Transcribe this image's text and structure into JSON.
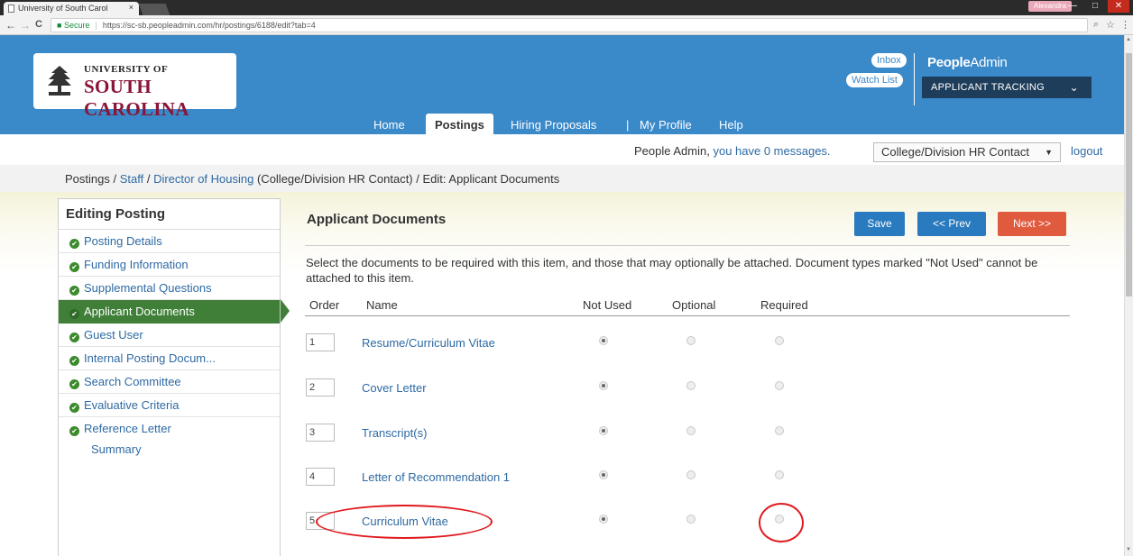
{
  "browser": {
    "tab_title": "University of South Carol",
    "tab_close": "×",
    "url_secure_label": "Secure",
    "url_separator": "|",
    "url": "https://sc-sb.peopleadmin.com/hr/postings/6188/edit?tab=4",
    "user_name": "Alexandra",
    "nav_back": "←",
    "nav_forward": "→",
    "nav_reload": "C",
    "zoom_icon": "zoom-icon",
    "star_icon": "☆",
    "menu_icon": "⋮",
    "minimize": "—",
    "maximize": "□",
    "close": "✕"
  },
  "header": {
    "logo_line1": "UNIVERSITY OF",
    "logo_line2": "SOUTH CAROLINA",
    "inbox_label": "Inbox",
    "watchlist_label": "Watch List",
    "brand_part1": "People",
    "brand_part2": "Admin",
    "module_select": "APPLICANT TRACKING",
    "module_chevron": "⌄",
    "nav": {
      "home": "Home",
      "postings": "Postings",
      "hiring_proposals": "Hiring Proposals",
      "separator": "|",
      "my_profile": "My Profile",
      "help": "Help"
    },
    "brand_color": "#3a89c9"
  },
  "messages": {
    "prefix": "People Admin,",
    "link": "you have 0 messages.",
    "role": "College/Division HR Contact",
    "role_arrow": "▼",
    "logout": "logout"
  },
  "breadcrumb": {
    "postings": "Postings",
    "sep1": " / ",
    "staff": "Staff",
    "sep2": " / ",
    "posting": "Director of Housing",
    "role_suffix": " (College/Division HR Contact)",
    "sep3": " / ",
    "current": "Edit: Applicant Documents"
  },
  "sidebar": {
    "title": "Editing Posting",
    "check_icon": "✔",
    "items": [
      {
        "label": "Posting Details"
      },
      {
        "label": "Funding Information"
      },
      {
        "label": "Supplemental Questions"
      },
      {
        "label": "Applicant Documents"
      },
      {
        "label": "Guest User"
      },
      {
        "label": "Internal Posting Docum..."
      },
      {
        "label": "Search Committee"
      },
      {
        "label": "Evaluative Criteria"
      },
      {
        "label": "Reference Letter"
      }
    ],
    "summary": "Summary",
    "active_color": "#3f7f37"
  },
  "main": {
    "title": "Applicant Documents",
    "save": "Save",
    "prev": "<< Prev",
    "next": "Next >>",
    "instructions": "Select the documents to be required with this item, and those that may optionally be attached. Document types marked \"Not Used\" cannot be attached to this item.",
    "columns": {
      "order": "Order",
      "name": "Name",
      "not_used": "Not Used",
      "optional": "Optional",
      "required": "Required"
    },
    "rows": [
      {
        "order": "1",
        "name": "Resume/Curriculum Vitae",
        "selected": "not_used"
      },
      {
        "order": "2",
        "name": "Cover Letter",
        "selected": "not_used"
      },
      {
        "order": "3",
        "name": "Transcript(s)",
        "selected": "not_used"
      },
      {
        "order": "4",
        "name": "Letter of Recommendation 1",
        "selected": "not_used"
      },
      {
        "order": "5",
        "name": "Curriculum Vitae",
        "selected": "not_used"
      }
    ],
    "colors": {
      "save": "#2a7abf",
      "prev": "#2a7abf",
      "next": "#e05a3e",
      "annotation": "#e0191e"
    }
  }
}
